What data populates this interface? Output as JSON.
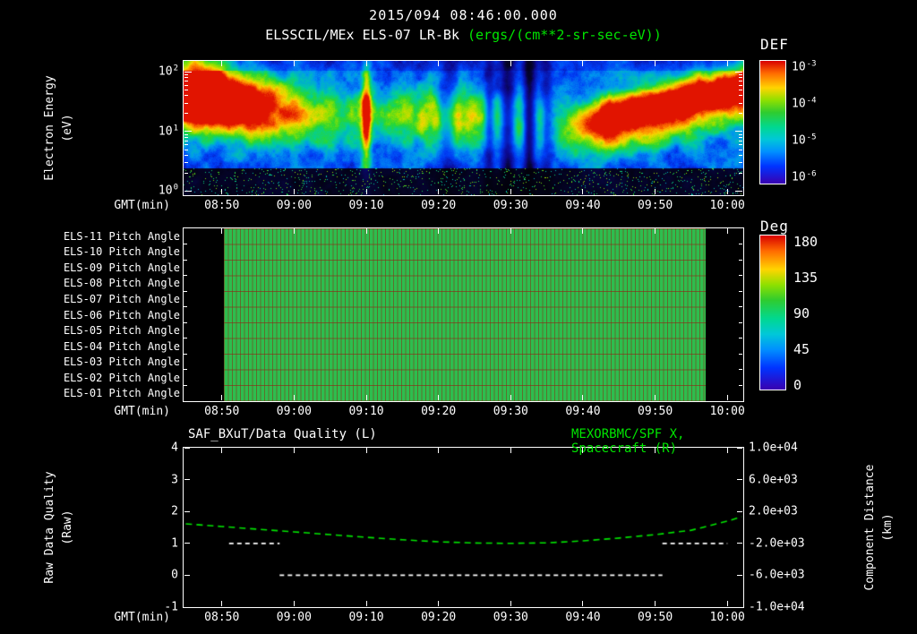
{
  "page": {
    "background": "#000000",
    "text_color": "#ffffff",
    "accent_green": "#00e500"
  },
  "header": {
    "title": "2015/094 08:46:00.000",
    "subtitle_instrument": "ELSSCIL/MEx ELS-07 LR-Bk",
    "subtitle_units": "(ergs/(cm**2-sr-sec-eV))"
  },
  "time_axis": {
    "label": "GMT(min)",
    "range_minutes": [
      44.7,
      122.2
    ],
    "ticks": [
      {
        "label": "08:50",
        "minute": 50
      },
      {
        "label": "09:00",
        "minute": 60
      },
      {
        "label": "09:10",
        "minute": 70
      },
      {
        "label": "09:20",
        "minute": 80
      },
      {
        "label": "09:30",
        "minute": 90
      },
      {
        "label": "09:40",
        "minute": 100
      },
      {
        "label": "09:50",
        "minute": 110
      },
      {
        "label": "10:00",
        "minute": 120
      }
    ]
  },
  "spectrogram": {
    "ylabel_line1": "Electron Energy",
    "ylabel_line2": "(eV)",
    "yticks": [
      {
        "base": "10",
        "exp": "2",
        "log": 2
      },
      {
        "base": "10",
        "exp": "1",
        "log": 1
      },
      {
        "base": "10",
        "exp": "0",
        "log": 0
      }
    ]
  },
  "def_colorbar": {
    "title": "DEF",
    "ticks": [
      {
        "base": "10",
        "exp": "-3"
      },
      {
        "base": "10",
        "exp": "-4"
      },
      {
        "base": "10",
        "exp": "-5"
      },
      {
        "base": "10",
        "exp": "-6"
      }
    ]
  },
  "pitch": {
    "rows": [
      "ELS-11 Pitch Angle",
      "ELS-10 Pitch Angle",
      "ELS-09 Pitch Angle",
      "ELS-08 Pitch Angle",
      "ELS-07 Pitch Angle",
      "ELS-06 Pitch Angle",
      "ELS-05 Pitch Angle",
      "ELS-04 Pitch Angle",
      "ELS-03 Pitch Angle",
      "ELS-02 Pitch Angle",
      "ELS-01 Pitch Angle"
    ]
  },
  "deg_colorbar": {
    "title": "Deg",
    "ticks": [
      "180",
      "135",
      "90",
      "45",
      "0"
    ]
  },
  "bottom": {
    "title_left": "SAF_BXuT/Data Quality (L)",
    "title_right": "MEXORBMC/SPF X, Spacecraft (R)",
    "left_label_line1": "Raw Data Quality",
    "left_label_line2": "(Raw)",
    "left_ticks": [
      "4",
      "3",
      "2",
      "1",
      "0",
      "-1"
    ],
    "right_label_line1": "Component Distance",
    "right_label_line2": "(km)",
    "right_ticks": [
      "1.0e+04",
      "6.0e+03",
      "2.0e+03",
      "-2.0e+03",
      "-6.0e+03",
      "-1.0e+04"
    ]
  },
  "chart_data": [
    {
      "type": "heatmap",
      "name": "electron-energy-spectrogram",
      "title": "ELSSCIL/MEx ELS-07 LR-Bk",
      "units": "ergs/(cm**2-sr-sec-eV)",
      "xlabel": "GMT(min)",
      "ylabel": "Electron Energy (eV)",
      "x_range": [
        "08:45",
        "10:02"
      ],
      "y_scale": "log",
      "y_range_ev": [
        1,
        100
      ],
      "color_scale": "log",
      "color_range": [
        1e-06,
        0.001
      ],
      "colorbar_label": "DEF",
      "features": [
        {
          "kind": "blob",
          "desc": "intense 10-60 eV flux at start 08:46-08:55, red-yellow core",
          "t": 0.015,
          "e": 0.73,
          "st": 0.05,
          "se": 0.13,
          "amp": 1.05
        },
        {
          "kind": "blob",
          "desc": "green-cyan flux reaching top of range at left edge",
          "t": 0.02,
          "e": 0.95,
          "st": 0.04,
          "se": 0.1,
          "amp": 0.5
        },
        {
          "kind": "blob",
          "desc": "decaying warm flux 08:50-09:02",
          "t": 0.08,
          "e": 0.68,
          "st": 0.07,
          "se": 0.15,
          "amp": 0.75
        },
        {
          "kind": "blob",
          "desc": "weak green band 09:00-09:10",
          "t": 0.18,
          "e": 0.6,
          "st": 0.08,
          "se": 0.16,
          "amp": 0.38
        },
        {
          "kind": "blob",
          "desc": "patchy green flux 09:08-09:28 at 3-30 eV",
          "t": 0.45,
          "e": 0.58,
          "st": 0.13,
          "se": 0.14,
          "amp": 0.45,
          "columnar": true
        },
        {
          "kind": "blob",
          "desc": "green patch near 09:30",
          "t": 0.6,
          "e": 0.5,
          "st": 0.05,
          "se": 0.16,
          "amp": 0.3
        },
        {
          "kind": "streak",
          "desc": "narrow bright vertical column at ~09:10",
          "t": 0.326,
          "e": 0.6,
          "st": 0.006,
          "se": 0.3,
          "amp": 0.6
        },
        {
          "kind": "band",
          "desc": "rising yellow-red energetic band 09:40-10:02 from ~8 eV to ~60 eV",
          "tStart": 0.66,
          "e0": 0.5,
          "slope": 0.95,
          "se": 0.11,
          "amp": 0.95
        },
        {
          "kind": "gap",
          "desc": "dark dropout column ~09:21",
          "t": 0.472,
          "st": 0.01,
          "depth": 0.45
        },
        {
          "kind": "gap",
          "desc": "dark dropout column ~09:27",
          "t": 0.545,
          "st": 0.008,
          "depth": 0.6
        },
        {
          "kind": "gap",
          "desc": "dark dropout column ~09:29",
          "t": 0.578,
          "st": 0.012,
          "depth": 0.8
        },
        {
          "kind": "gap",
          "desc": "dark dropout column ~09:32",
          "t": 0.617,
          "st": 0.01,
          "depth": 0.85
        },
        {
          "kind": "gap",
          "desc": "dark dropout column ~09:35",
          "t": 0.648,
          "st": 0.009,
          "depth": 0.5
        }
      ]
    },
    {
      "type": "heatmap",
      "name": "pitch-angle-panels",
      "rows_top_to_bottom": [
        "ELS-11 Pitch Angle",
        "ELS-10 Pitch Angle",
        "ELS-09 Pitch Angle",
        "ELS-08 Pitch Angle",
        "ELS-07 Pitch Angle",
        "ELS-06 Pitch Angle",
        "ELS-05 Pitch Angle",
        "ELS-04 Pitch Angle",
        "ELS-03 Pitch Angle",
        "ELS-02 Pitch Angle",
        "ELS-01 Pitch Angle"
      ],
      "value_deg": 95,
      "coverage": [
        "08:50",
        "09:57"
      ],
      "coverage_minutes": [
        50.3,
        117
      ],
      "colorbar_label": "Deg",
      "color_range_deg": [
        0,
        180
      ]
    },
    {
      "type": "line",
      "name": "quality-and-spacecraft-distance",
      "title_left": "SAF_BXuT/Data Quality (L)",
      "title_right": "MEXORBMC/SPF X, Spacecraft (R)",
      "xlabel": "GMT(min)",
      "left_axis": {
        "label": "Raw Data Quality (Raw)",
        "range": [
          -1,
          4
        ]
      },
      "right_axis": {
        "label": "Component Distance (km)",
        "range": [
          -10000,
          10000
        ]
      },
      "series": [
        {
          "name": "Raw Data Quality",
          "axis": "left",
          "style": "dashed-white",
          "segments": [
            {
              "x": [
                "08:51",
                "08:58"
              ],
              "value": 1
            },
            {
              "x": [
                "08:58",
                "09:51"
              ],
              "value": 0
            },
            {
              "x": [
                "09:51",
                "10:00"
              ],
              "value": 1
            }
          ]
        },
        {
          "name": "MEXORBMC/SPF X Spacecraft",
          "axis": "right",
          "style": "dashed-green",
          "points": [
            [
              "08:45",
              450
            ],
            [
              "08:50",
              120
            ],
            [
              "08:55",
              -230
            ],
            [
              "09:00",
              -560
            ],
            [
              "09:05",
              -900
            ],
            [
              "09:10",
              -1240
            ],
            [
              "09:15",
              -1550
            ],
            [
              "09:20",
              -1800
            ],
            [
              "09:25",
              -1950
            ],
            [
              "09:30",
              -2000
            ],
            [
              "09:35",
              -1930
            ],
            [
              "09:40",
              -1690
            ],
            [
              "09:45",
              -1330
            ],
            [
              "09:50",
              -900
            ],
            [
              "09:55",
              -350
            ],
            [
              "10:00",
              790
            ],
            [
              "10:02",
              1350
            ]
          ]
        }
      ]
    }
  ]
}
